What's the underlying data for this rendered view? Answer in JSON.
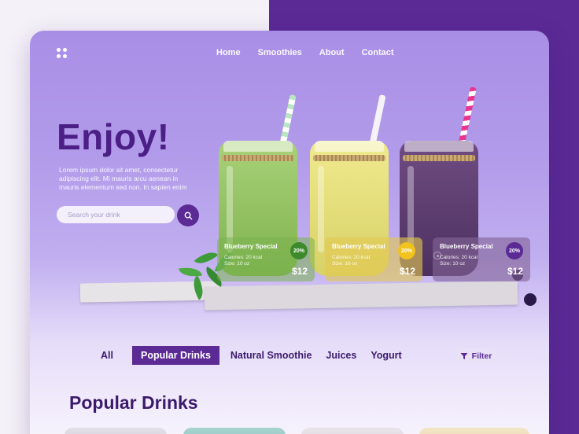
{
  "nav": {
    "items": [
      {
        "label": "Home"
      },
      {
        "label": "Smoothies"
      },
      {
        "label": "About"
      },
      {
        "label": "Contact"
      }
    ]
  },
  "hero": {
    "title": "Enjoy!",
    "description": "Lorem ipsum dolor sit amet, consectetur adipiscing elit. Mi mauris arcu aenean in mauris elementum sed non. In sapien enim",
    "search_placeholder": "Search your drink"
  },
  "drinks": [
    {
      "name": "Blueberry Special",
      "calories": "Calories: 20 kcal",
      "size": "Size: 10 oz",
      "price": "$12",
      "discount": "20%",
      "badge_color": "#3d8a2c"
    },
    {
      "name": "Blueberry Special",
      "calories": "Calories: 20 kcal",
      "size": "Size: 10 oz",
      "price": "$12",
      "discount": "20%",
      "badge_color": "#f2c21d"
    },
    {
      "name": "Blueberry Special",
      "calories": "Calories: 20 kcal",
      "size": "Size: 10 oz",
      "price": "$12",
      "discount": "20%",
      "badge_color": "#5b2a95"
    }
  ],
  "filters": {
    "tabs": [
      {
        "label": "All",
        "active": false
      },
      {
        "label": "Popular Drinks",
        "active": true
      },
      {
        "label": "Natural Smoothie",
        "active": false
      },
      {
        "label": "Juices",
        "active": false
      },
      {
        "label": "Yogurt",
        "active": false
      }
    ],
    "filter_label": "Filter"
  },
  "section": {
    "title": "Popular Drinks"
  },
  "colors": {
    "accent": "#5b2a95",
    "green_jar": "#8fc25a",
    "yellow_jar": "#e9e27a",
    "purple_jar": "#5c3d6e"
  }
}
